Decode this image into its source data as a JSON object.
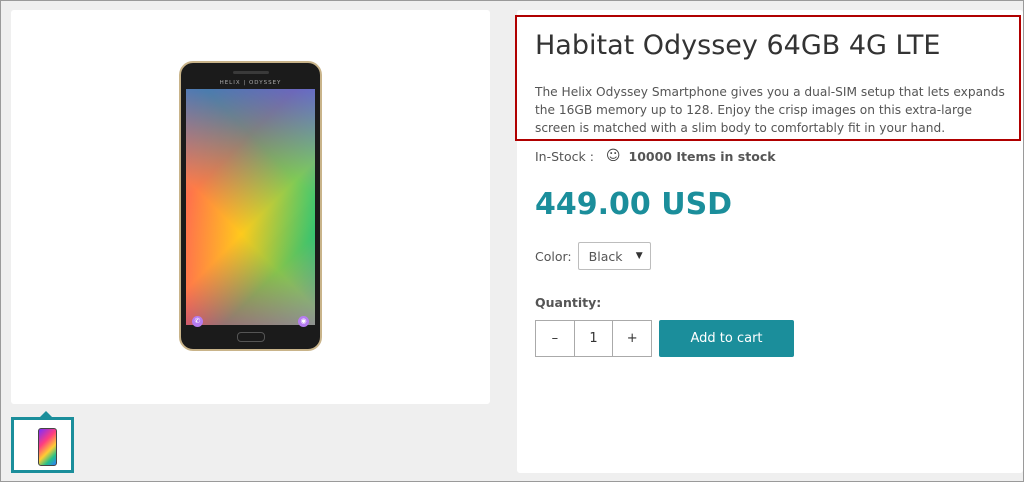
{
  "product": {
    "title": "Habitat Odyssey 64GB 4G LTE",
    "description": "The Helix Odyssey Smartphone gives you a dual-SIM setup that lets expands the 16GB memory up to 128. Enjoy the crisp images on this extra-large screen is matched with a slim body to comfortably fit in your hand.",
    "brand_on_device": "HELIX | ODYSSEY",
    "stock_label": "In-Stock :",
    "stock_icon": "smile-icon",
    "stock_count": "10000 Items in stock",
    "price": "449.00 USD",
    "color_label": "Color:",
    "color_value": "Black",
    "quantity_label": "Quantity:",
    "quantity_value": "1",
    "decrement": "–",
    "increment": "+",
    "add_to_cart": "Add to cart"
  },
  "colors": {
    "accent": "#1b8e9b",
    "highlight_border": "#b00000"
  }
}
